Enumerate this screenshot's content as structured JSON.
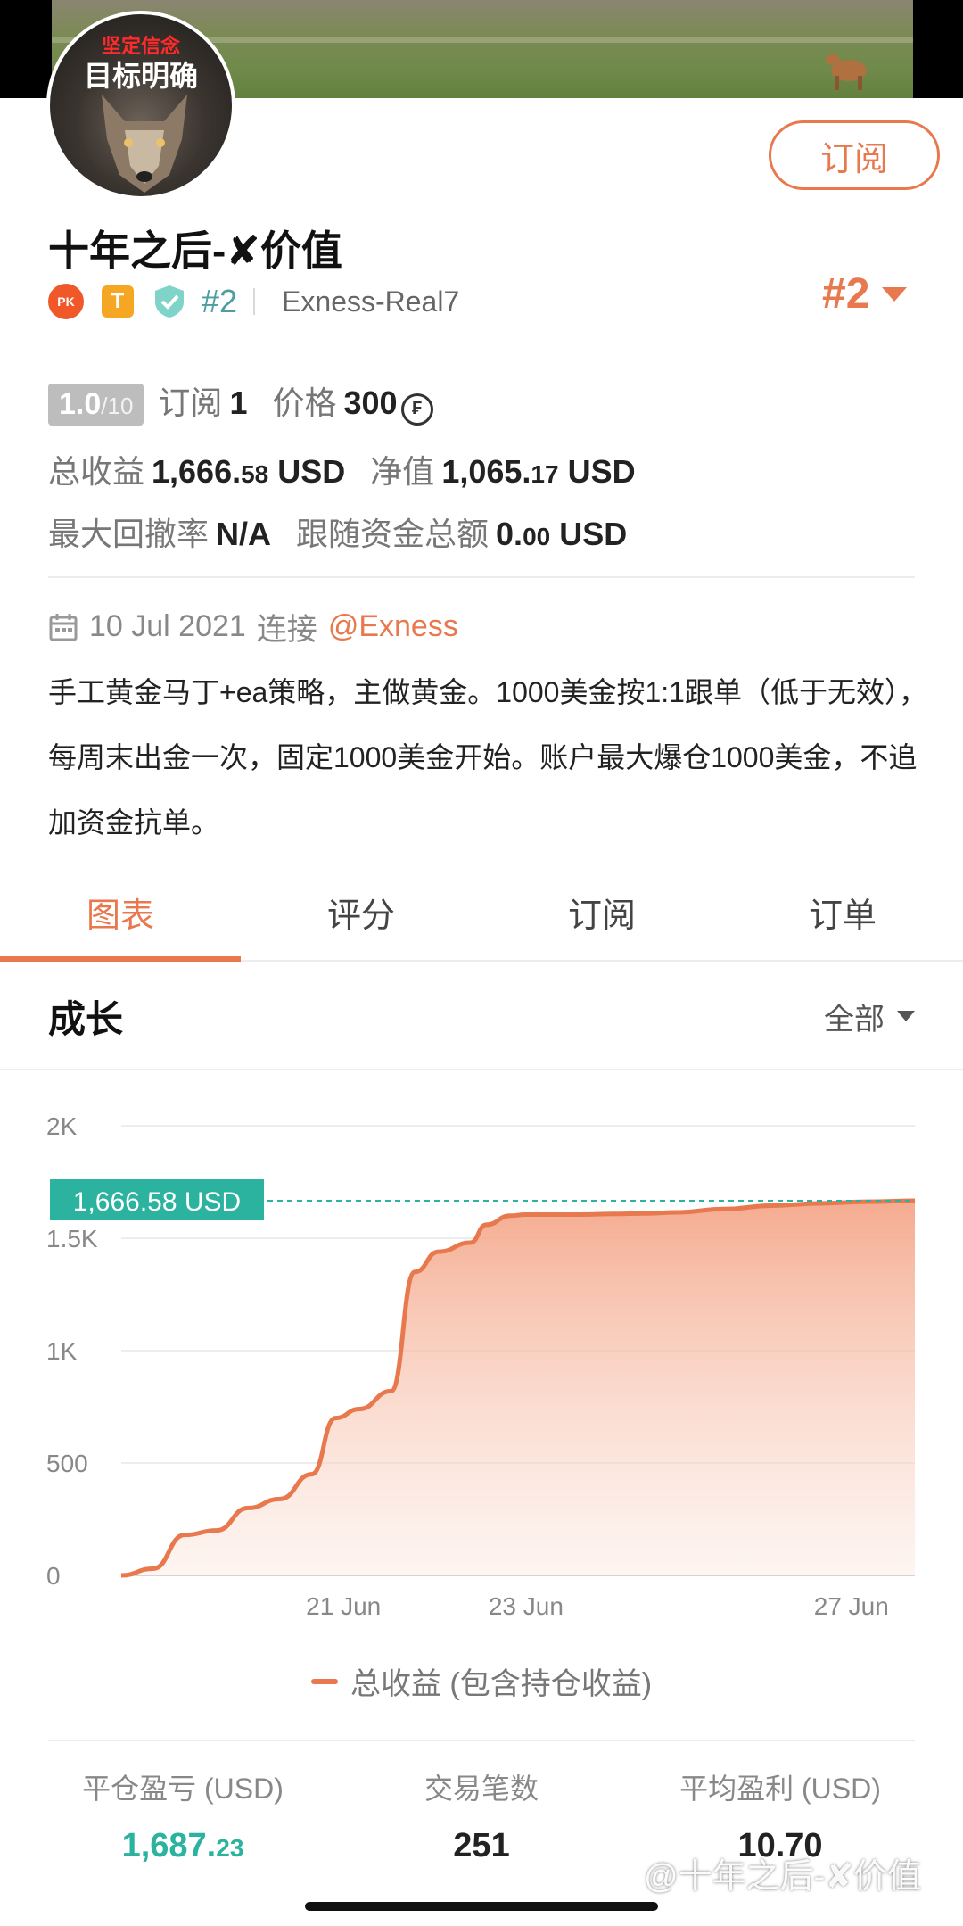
{
  "avatar": {
    "top_text": "坚定信念",
    "main_text": "目标明确"
  },
  "header": {
    "subscribe_label": "订阅"
  },
  "profile": {
    "name": "十年之后-✘价值",
    "badge_pk": "PK",
    "badge_t": "T",
    "rank_small": "#2",
    "server": "Exness-Real7",
    "rank_big": "#2"
  },
  "stats": {
    "score": "1.0",
    "score_max": "/10",
    "subscribers_label": "订阅",
    "subscribers_value": "1",
    "price_label": "价格",
    "price_value": "300",
    "price_currency_icon": "₣",
    "total_profit_label": "总收益",
    "total_profit_main": "1,666.",
    "total_profit_dec": "58",
    "total_profit_unit": "USD",
    "equity_label": "净值",
    "equity_main": "1,065.",
    "equity_dec": "17",
    "equity_unit": "USD",
    "max_drawdown_label": "最大回撤率",
    "max_drawdown_value": "N/A",
    "follow_funds_label": "跟随资金总额",
    "follow_funds_main": "0.",
    "follow_funds_dec": "00",
    "follow_funds_unit": "USD"
  },
  "connection": {
    "date": "10 Jul 2021",
    "connect_label": "连接",
    "broker_link": "@Exness"
  },
  "description": "手工黄金马丁+ea策略，主做黄金。1000美金按1:1跟单（低于无效），每周末出金一次，固定1000美金开始。账户最大爆仓1000美金，不追加资金抗单。",
  "tabs": [
    "图表",
    "评分",
    "订阅",
    "订单"
  ],
  "growth": {
    "title": "成长",
    "filter": "全部"
  },
  "chart_data": {
    "type": "area",
    "title": "",
    "ylabel": "",
    "xlabel": "",
    "y_ticks": [
      "0",
      "500",
      "1K",
      "1.5K",
      "2K"
    ],
    "x_ticks": [
      "21 Jun",
      "23 Jun",
      "27 Jun"
    ],
    "ylim": [
      0,
      2000
    ],
    "current_value_label": "1,666.58 USD",
    "current_value": 1666.58,
    "series": [
      {
        "name": "总收益 (包含持仓收益)",
        "color": "#e8784d",
        "x": [
          0,
          0.04,
          0.08,
          0.12,
          0.16,
          0.2,
          0.24,
          0.27,
          0.3,
          0.34,
          0.37,
          0.4,
          0.44,
          0.46,
          0.49,
          0.51,
          0.54,
          0.58,
          0.62,
          0.66,
          0.7,
          0.76,
          0.82,
          0.88,
          0.94,
          1.0
        ],
        "values": [
          0,
          30,
          180,
          200,
          300,
          340,
          450,
          700,
          740,
          820,
          1350,
          1440,
          1480,
          1560,
          1600,
          1605,
          1605,
          1605,
          1608,
          1610,
          1615,
          1630,
          1645,
          1655,
          1662,
          1666.58
        ]
      }
    ]
  },
  "legend_label": "总收益 (包含持仓收益)",
  "summary": {
    "closed_pl_label": "平仓盈亏 (USD)",
    "closed_pl_main": "1,687.",
    "closed_pl_dec": "23",
    "trades_label": "交易笔数",
    "trades_value": "251",
    "avg_profit_label": "平均盈利 (USD)",
    "avg_profit_value": "10.70"
  },
  "watermark": "@十年之后-✘价值",
  "colors": {
    "accent": "#e8784d",
    "teal": "#2bb39f",
    "rank_teal": "#4c9ea0"
  }
}
